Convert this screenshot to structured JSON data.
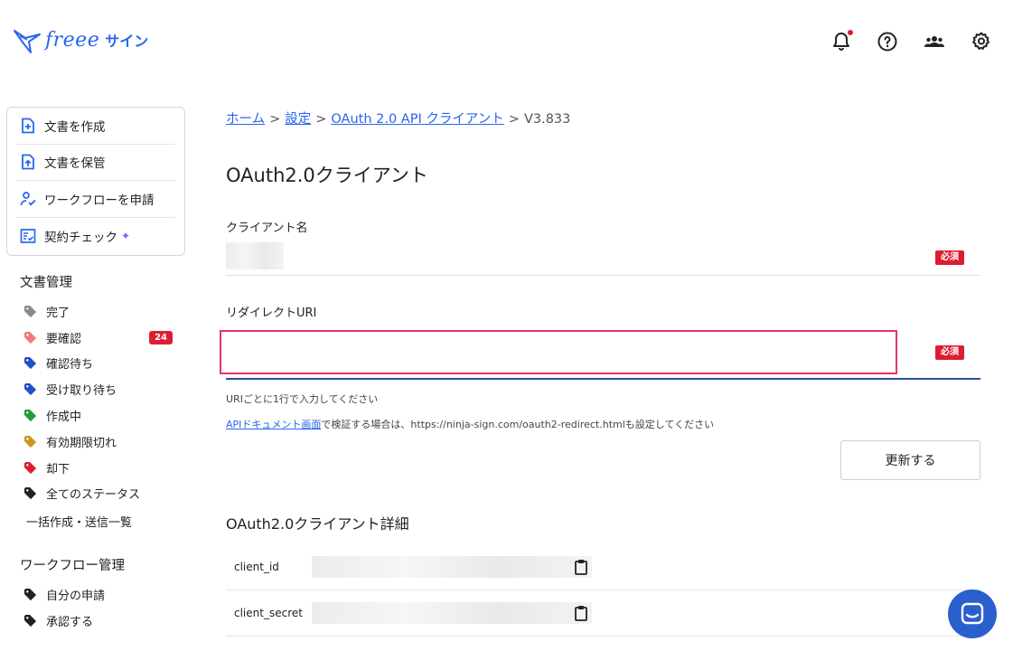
{
  "header": {
    "logo_text": "freee",
    "logo_sub": "サイン",
    "icons": [
      "bell-icon",
      "help-icon",
      "users-icon",
      "gear-icon"
    ]
  },
  "sidebar": {
    "actions": [
      {
        "label": "文書を作成",
        "icon": "file-plus-icon"
      },
      {
        "label": "文書を保管",
        "icon": "file-upload-icon"
      },
      {
        "label": "ワークフローを申請",
        "icon": "user-check-icon"
      },
      {
        "label": "契約チェック",
        "icon": "checklist-icon"
      }
    ],
    "doc_section_title": "文書管理",
    "statuses": [
      {
        "label": "完了",
        "color": "#8a8a8a"
      },
      {
        "label": "要確認",
        "color": "#f07a7a",
        "badge": "24"
      },
      {
        "label": "確認待ち",
        "color": "#2151c6"
      },
      {
        "label": "受け取り待ち",
        "color": "#2151c6"
      },
      {
        "label": "作成中",
        "color": "#1e9e3c"
      },
      {
        "label": "有効期限切れ",
        "color": "#c99a1e"
      },
      {
        "label": "却下",
        "color": "#dc1e32"
      },
      {
        "label": "全てのステータス",
        "color": "#222222"
      }
    ],
    "bulk_link": "一括作成・送信一覧",
    "workflow_section_title": "ワークフロー管理",
    "workflow_items": [
      {
        "label": "自分の申請",
        "color": "#222222"
      },
      {
        "label": "承認する",
        "color": "#222222"
      }
    ]
  },
  "breadcrumb": {
    "home": "ホーム",
    "settings": "設定",
    "oauth": "OAuth 2.0 API クライアント",
    "current": "V3.833",
    "sep": ">"
  },
  "main": {
    "title": "OAuth2.0クライアント",
    "client_name_label": "クライアント名",
    "required_label": "必須",
    "redirect_label": "リダイレクトURI",
    "redirect_value": "",
    "hint_1": "URIごとに1行で入力してください",
    "hint_2_link": "APIドキュメント画面",
    "hint_2_rest": "で検証する場合は、https://ninja-sign.com/oauth2-redirect.htmlも設定してください",
    "update_button": "更新する",
    "details_title": "OAuth2.0クライアント詳細",
    "details": [
      {
        "key": "client_id"
      },
      {
        "key": "client_secret"
      }
    ]
  },
  "colors": {
    "accent": "#2864f0",
    "required": "#dc1e32",
    "highlight": "#e8316f",
    "chat": "#2a5fce"
  }
}
